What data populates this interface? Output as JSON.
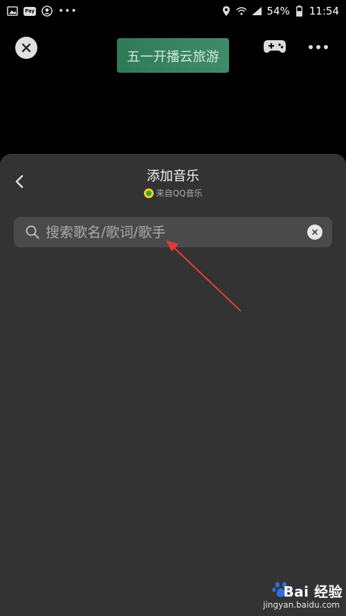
{
  "status_bar": {
    "battery": "54%",
    "time": "11:54",
    "network": "4G",
    "pay_label": "Pay"
  },
  "top": {
    "title_chip": "五一开播云旅游"
  },
  "sheet": {
    "title": "添加音乐",
    "source": "来自QQ音乐",
    "search_placeholder": "搜索歌名/歌词/歌手"
  },
  "watermark": {
    "brand": "Bai 经验",
    "url": "jingyan.baidu.com"
  },
  "colors": {
    "sheet_bg": "#333333",
    "chip_bg": "#3a8663",
    "arrow": "#e53935"
  }
}
